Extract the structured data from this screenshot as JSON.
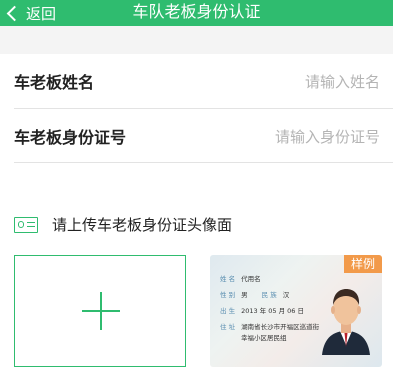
{
  "header": {
    "back_label": "返回",
    "title": "车队老板身份认证"
  },
  "form": {
    "name_label": "车老板姓名",
    "name_placeholder": "请输入姓名",
    "id_label": "车老板身份证号",
    "id_placeholder": "请输入身份证号"
  },
  "upload": {
    "heading": "请上传车老板身份证头像面",
    "sample_badge": "样例",
    "sample_card": {
      "name_key": "姓 名",
      "name_val": "代用名",
      "sex_key": "性 别",
      "sex_val": "男",
      "ethnic_key": "民 族",
      "ethnic_val": "汉",
      "birth_key": "出 生",
      "birth_val": "2013 年 05 月 06 日",
      "addr_key": "住 址",
      "addr_line1": "湖南省长沙市开福区巡道街",
      "addr_line2": "幸福小区居民组"
    }
  },
  "colors": {
    "accent": "#2fbc6f",
    "badge": "#f29a4a"
  }
}
